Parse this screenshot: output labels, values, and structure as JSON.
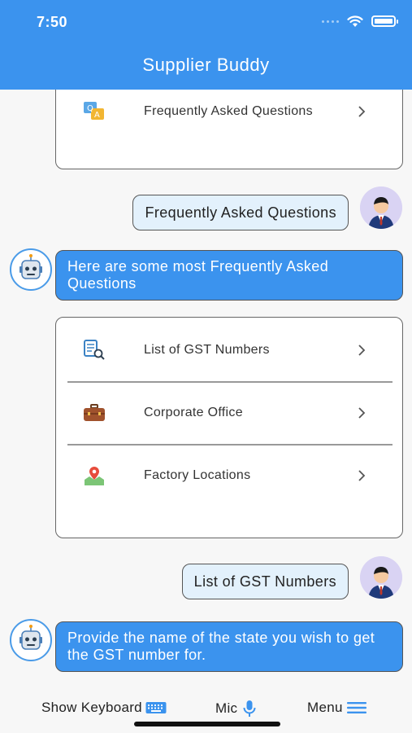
{
  "status_bar": {
    "time": "7:50"
  },
  "header": {
    "title": "Supplier Buddy"
  },
  "chat": {
    "top_card": {
      "items": [
        {
          "label": "Frequently Asked Questions",
          "icon": "faq-icon"
        }
      ]
    },
    "messages": [
      {
        "from": "user",
        "text": "Frequently Asked Questions"
      },
      {
        "from": "bot",
        "text": "Here are some most Frequently Asked Questions"
      },
      {
        "from": "user",
        "text": "List of GST Numbers"
      },
      {
        "from": "bot",
        "text": "Provide the name of the state you wish to get the GST number for."
      }
    ],
    "faq_card": {
      "items": [
        {
          "label": "List of GST Numbers",
          "icon": "document-search-icon"
        },
        {
          "label": "Corporate Office",
          "icon": "briefcase-icon"
        },
        {
          "label": "Factory Locations",
          "icon": "map-pin-icon"
        }
      ]
    }
  },
  "bottom_bar": {
    "keyboard_label": "Show Keyboard",
    "mic_label": "Mic",
    "menu_label": "Menu"
  },
  "colors": {
    "accent": "#3b93ee",
    "user_bubble": "#e3f1fc",
    "background": "#f7f7f7"
  }
}
